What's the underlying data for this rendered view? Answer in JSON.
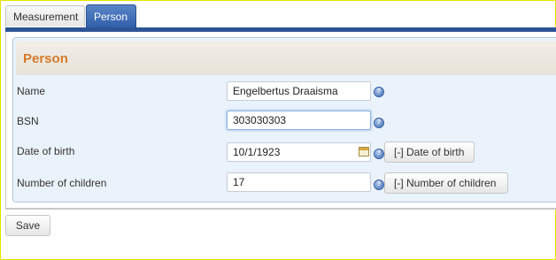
{
  "tabs": [
    {
      "label": "Measurement",
      "active": false
    },
    {
      "label": "Person",
      "active": true
    }
  ],
  "panel": {
    "title": "Person",
    "fields": [
      {
        "label": "Name",
        "value": "Engelbertus Draaisma"
      },
      {
        "label": "BSN",
        "value": "303030303"
      },
      {
        "label": "Date of birth",
        "value": "10/1/1923",
        "button": "[-] Date of birth"
      },
      {
        "label": "Number of children",
        "value": "17",
        "button": "[-] Number of children"
      }
    ]
  },
  "actions": {
    "save_label": "Save"
  },
  "colors": {
    "tab_active": "#2f5da8",
    "panel_bg": "#eaf3fb",
    "title": "#d57a2a"
  }
}
